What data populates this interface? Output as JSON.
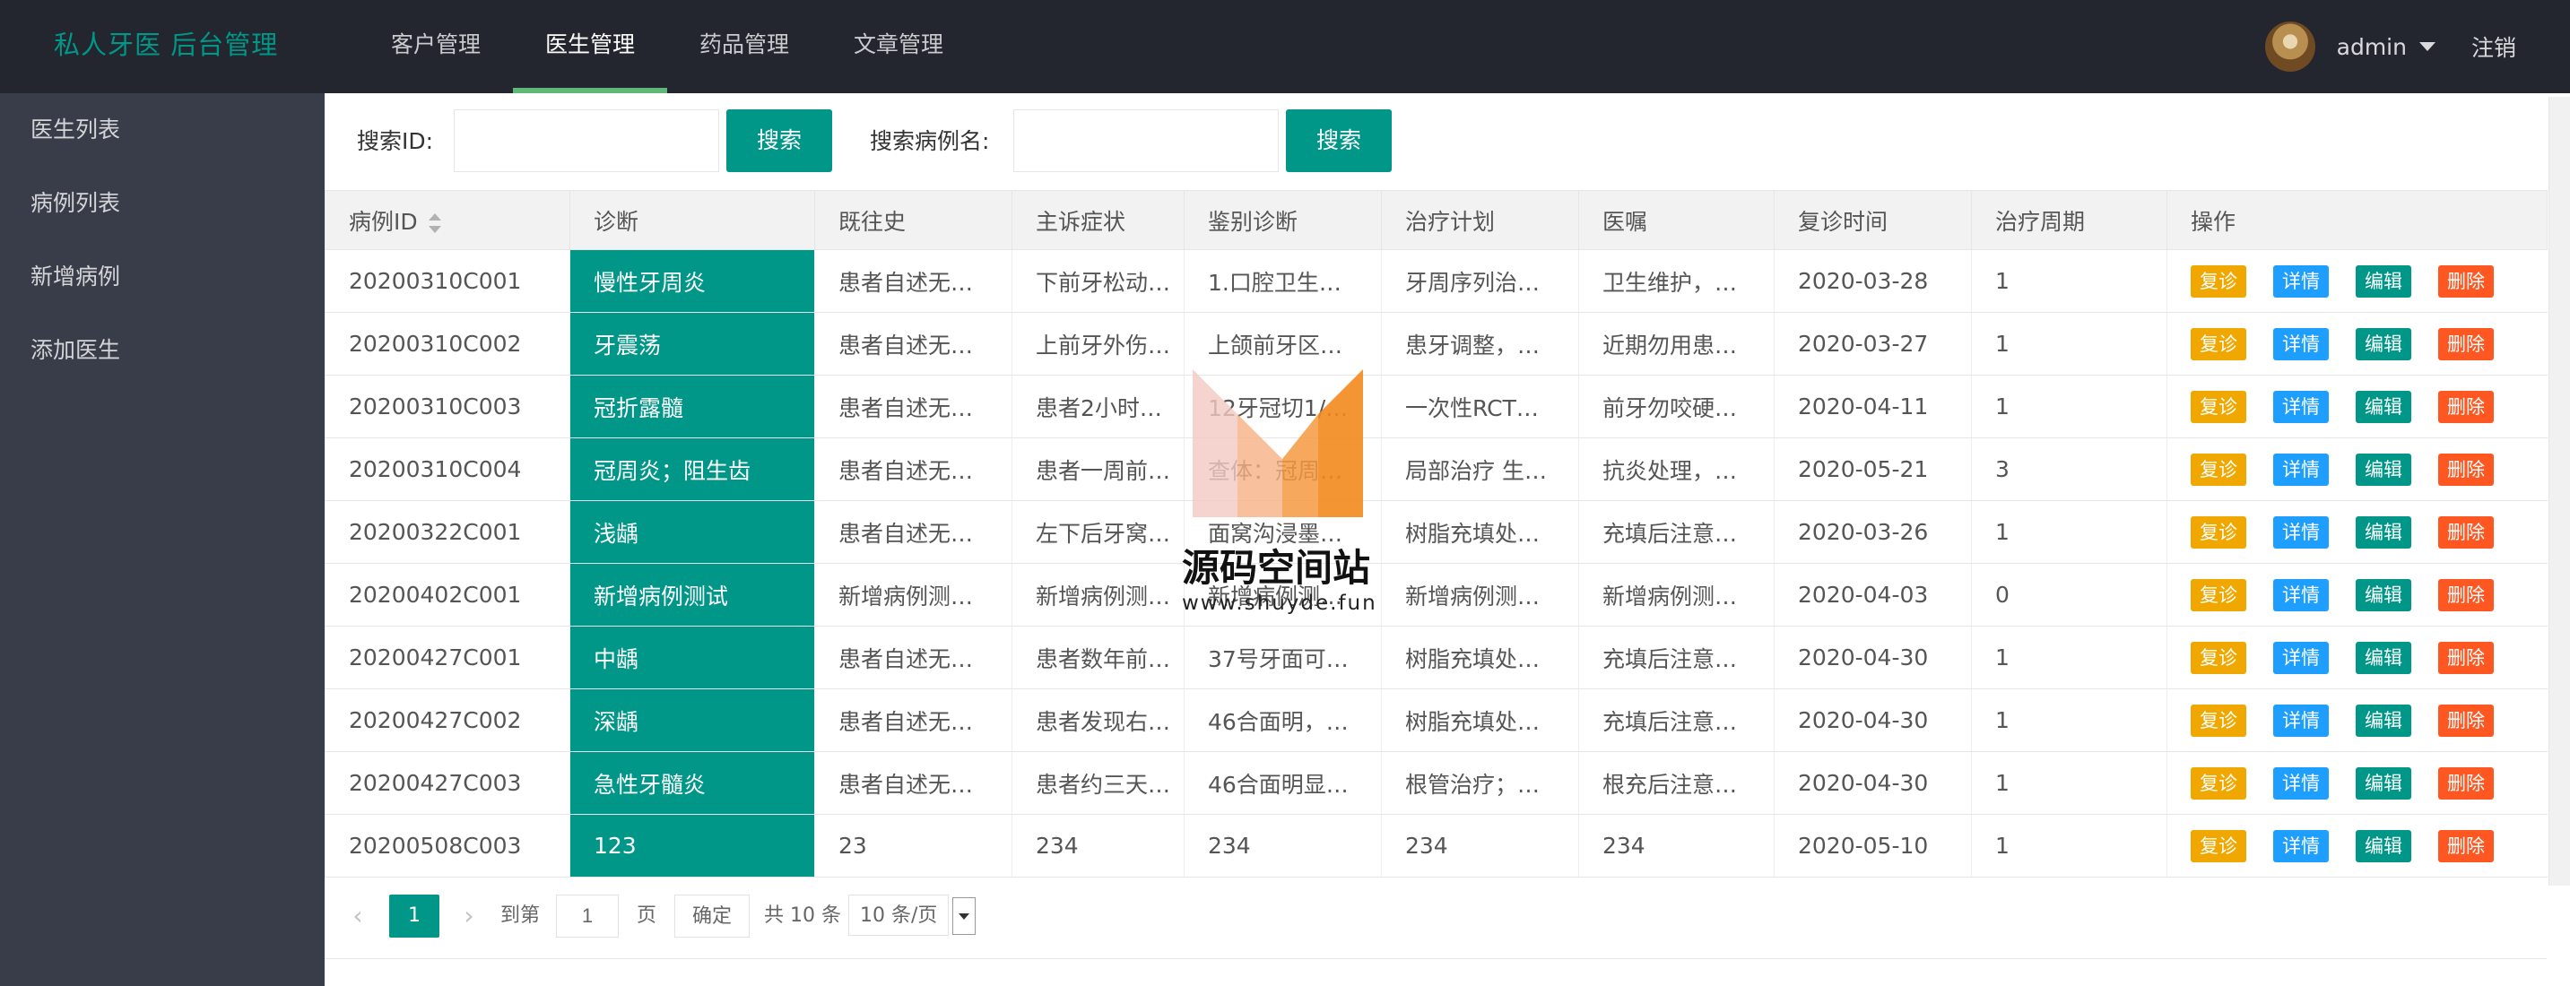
{
  "header": {
    "logo": "私人牙医 后台管理",
    "nav": [
      {
        "label": "客户管理",
        "active": false
      },
      {
        "label": "医生管理",
        "active": true
      },
      {
        "label": "药品管理",
        "active": false
      },
      {
        "label": "文章管理",
        "active": false
      }
    ],
    "username": "admin",
    "logout": "注销"
  },
  "sidebar": {
    "items": [
      "医生列表",
      "病例列表",
      "新增病例",
      "添加医生"
    ]
  },
  "search": {
    "id_label": "搜索ID:",
    "id_value": "",
    "btn1": "搜索",
    "case_label": "搜索病例名:",
    "case_value": "",
    "btn2": "搜索"
  },
  "table": {
    "headers": [
      "病例ID",
      "诊断",
      "既往史",
      "主诉症状",
      "鉴别诊断",
      "治疗计划",
      "医嘱",
      "复诊时间",
      "治疗周期",
      "操作"
    ],
    "rows": [
      [
        "20200310C001",
        "慢性牙周炎",
        "患者自述无…",
        "下前牙松动…",
        "1.口腔卫生…",
        "牙周序列治…",
        "卫生维护，…",
        "2020-03-28",
        "1"
      ],
      [
        "20200310C002",
        "牙震荡",
        "患者自述无…",
        "上前牙外伤…",
        "上颌前牙区…",
        "患牙调整，…",
        "近期勿用患…",
        "2020-03-27",
        "1"
      ],
      [
        "20200310C003",
        "冠折露髓",
        "患者自述无…",
        "患者2小时…",
        "12牙冠切1/…",
        "一次性RCT…",
        "前牙勿咬硬…",
        "2020-04-11",
        "1"
      ],
      [
        "20200310C004",
        "冠周炎；阻生齿",
        "患者自述无…",
        "患者一周前…",
        "查体：冠周…",
        "局部治疗 生…",
        "抗炎处理，…",
        "2020-05-21",
        "3"
      ],
      [
        "20200322C001",
        "浅龋",
        "患者自述无…",
        "左下后牙窝…",
        "面窝沟浸墨…",
        "树脂充填处…",
        "充填后注意…",
        "2020-03-26",
        "1"
      ],
      [
        "20200402C001",
        "新增病例测试",
        "新增病例测…",
        "新增病例测…",
        "新增病例测…",
        "新增病例测…",
        "新增病例测…",
        "2020-04-03",
        "0"
      ],
      [
        "20200427C001",
        "中龋",
        "患者自述无…",
        "患者数年前…",
        "37号牙面可…",
        "树脂充填处…",
        "充填后注意…",
        "2020-04-30",
        "1"
      ],
      [
        "20200427C002",
        "深龋",
        "患者自述无…",
        "患者发现右…",
        "46合面明，…",
        "树脂充填处…",
        "充填后注意…",
        "2020-04-30",
        "1"
      ],
      [
        "20200427C003",
        "急性牙髓炎",
        "患者自述无…",
        "患者约三天…",
        "46合面明显…",
        "根管治疗；…",
        "根充后注意…",
        "2020-04-30",
        "1"
      ],
      [
        "20200508C003",
        "123",
        "23",
        "234",
        "234",
        "234",
        "234",
        "2020-05-10",
        "1"
      ]
    ],
    "ops": {
      "review": "复诊",
      "detail": "详情",
      "edit": "编辑",
      "delete": "删除"
    }
  },
  "pager": {
    "prev": "‹",
    "current": "1",
    "next": "›",
    "goto": "到第",
    "page_input": "1",
    "page_unit": "页",
    "confirm": "确定",
    "total": "共 10 条",
    "per_page": "10 条/页"
  },
  "watermark": {
    "title": "源码空间站",
    "url": "www.shuyde.fun"
  },
  "colors": {
    "header_bg": "#23262e",
    "sidebar_bg": "#393d49",
    "accent": "#009688",
    "op_yellow": "#f0a800",
    "op_blue": "#1e9fff",
    "op_red": "#ff5722"
  }
}
